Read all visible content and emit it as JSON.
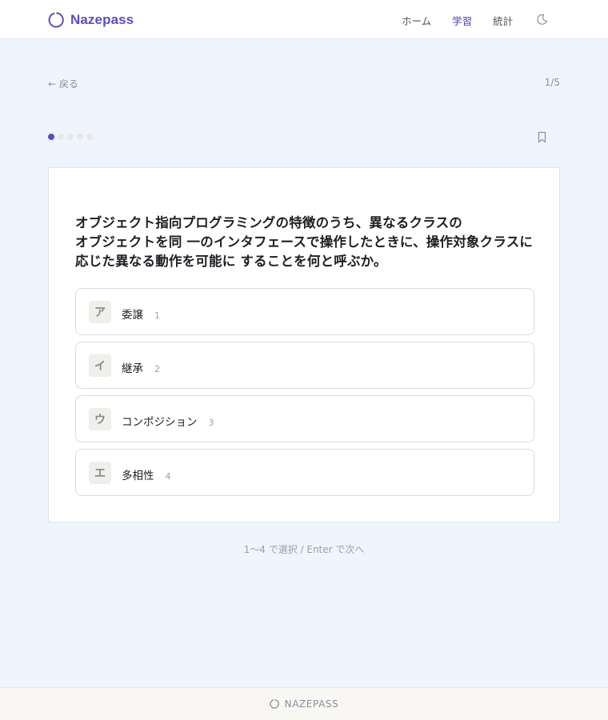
{
  "header": {
    "brand": "Nazepass",
    "nav": [
      {
        "label": "ホーム",
        "active": false
      },
      {
        "label": "学習",
        "active": true
      },
      {
        "label": "統計",
        "active": false
      }
    ]
  },
  "subnav": {
    "back_label": "← 戻る",
    "progress": "1/5"
  },
  "progress_dots": {
    "total": 5,
    "current": 1
  },
  "question": {
    "line1": "オブジェクト指向プログラミングの特徴のうち、異なるクラスの",
    "line2": "オブジェクトを同 一のインタフェースで操作したときに、操作対象クラスに",
    "line3": "応じた異なる動作を可能に することを何と呼ぶか。"
  },
  "choices": [
    {
      "key": "ア",
      "label": "委譲",
      "number": "1"
    },
    {
      "key": "イ",
      "label": "継承",
      "number": "2"
    },
    {
      "key": "ウ",
      "label": "コンポジション",
      "number": "3"
    },
    {
      "key": "エ",
      "label": "多相性",
      "number": "4"
    }
  ],
  "hint": "1〜4 で選択 / Enter で次へ",
  "footer": {
    "brand": "NAZEPASS"
  },
  "colors": {
    "accent": "#5a4ec4",
    "background": "#f0f4fd",
    "card": "#ffffff"
  },
  "icons": {
    "brand": "ring-logo-icon",
    "theme": "moon-icon",
    "bookmark": "bookmark-icon"
  }
}
